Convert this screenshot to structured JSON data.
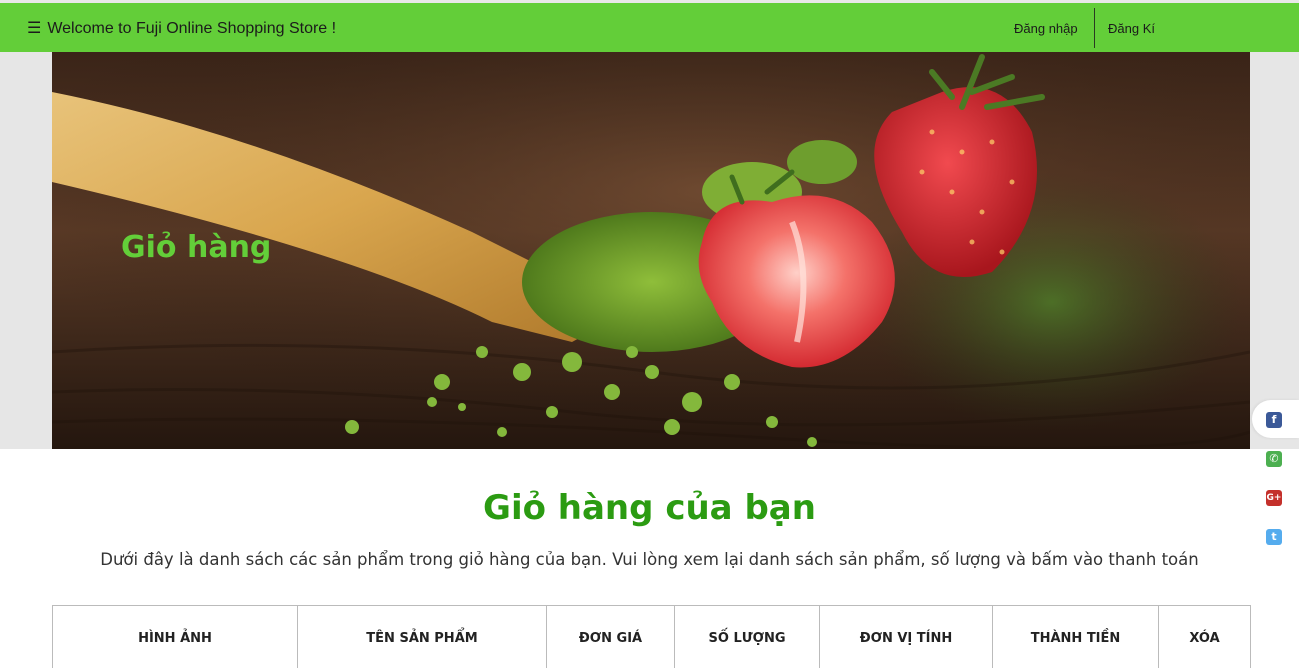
{
  "header": {
    "welcome_text": "Welcome to Fuji Online Shopping Store !",
    "menu_icon": "☰",
    "login_label": "Đăng nhập",
    "register_label": "Đăng Kí",
    "bg_color": "#63ce39"
  },
  "hero": {
    "title": "Giỏ hàng",
    "image_description_icon": "matcha-strawberry-banner"
  },
  "social": {
    "items": [
      {
        "name": "facebook-icon",
        "glyph": "f",
        "color": "#3b5998"
      },
      {
        "name": "phone-icon",
        "glyph": "✆",
        "color": "#4caf50"
      },
      {
        "name": "google-plus-icon",
        "glyph": "G+",
        "color": "#c4302b"
      },
      {
        "name": "twitter-icon",
        "glyph": "t",
        "color": "#55acee"
      }
    ]
  },
  "main": {
    "heading": "Giỏ hàng của bạn",
    "description": "Dưới đây là danh sách các sản phẩm trong giỏ hàng của bạn. Vui lòng xem lại danh sách sản phẩm, số lượng và bấm vào thanh toán",
    "heading_color": "#2b9b12"
  },
  "table": {
    "headers": [
      "HÌNH ẢNH",
      "TÊN SẢN PHẨM",
      "ĐƠN GIÁ",
      "SỐ LƯỢNG",
      "ĐƠN VỊ TÍNH",
      "THÀNH TIỀN",
      "XÓA"
    ]
  }
}
